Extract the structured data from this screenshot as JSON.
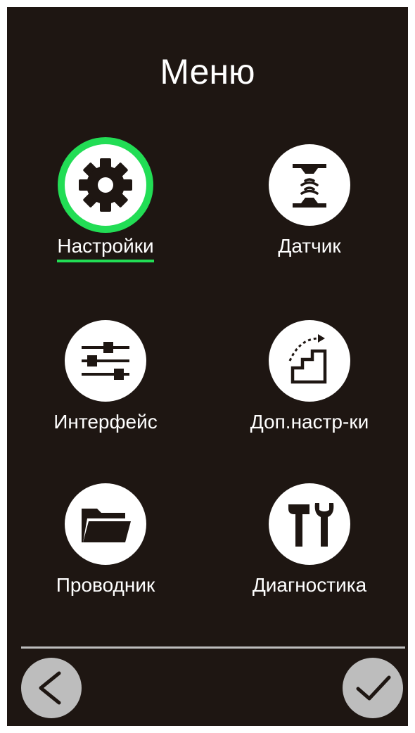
{
  "title": "Меню",
  "menu": {
    "items": [
      {
        "label": "Настройки",
        "icon": "gear-icon",
        "selected": true
      },
      {
        "label": "Датчик",
        "icon": "sensor-icon",
        "selected": false
      },
      {
        "label": "Интерфейс",
        "icon": "sliders-icon",
        "selected": false
      },
      {
        "label": "Доп.настр-ки",
        "icon": "stairs-icon",
        "selected": false
      },
      {
        "label": "Проводник",
        "icon": "folder-icon",
        "selected": false
      },
      {
        "label": "Диагностика",
        "icon": "tools-icon",
        "selected": false
      }
    ]
  },
  "footer": {
    "back_icon": "back-arrow-icon",
    "confirm_icon": "checkmark-icon"
  },
  "colors": {
    "background": "#1e1612",
    "selection": "#22dd55",
    "icon_background": "#ffffff",
    "nav_button": "#bdbdbd"
  }
}
